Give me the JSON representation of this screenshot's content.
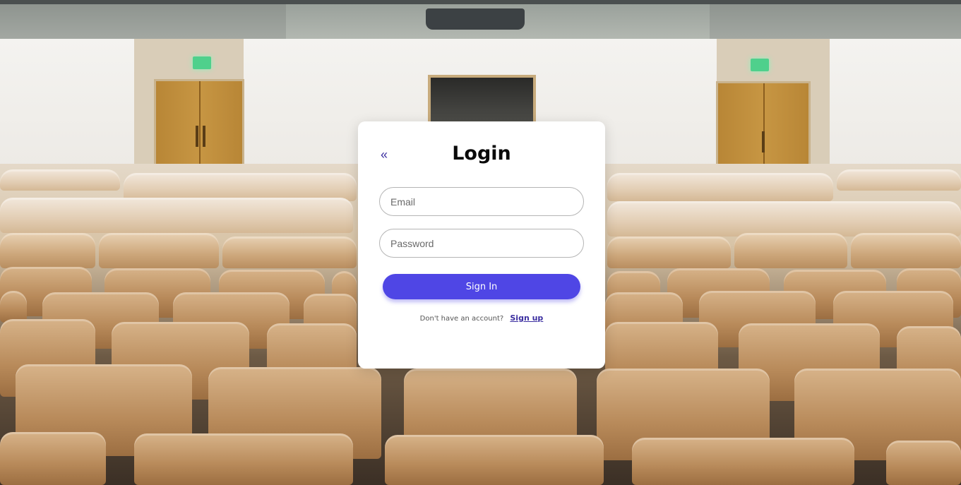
{
  "login": {
    "back_icon": "«",
    "title": "Login",
    "email_placeholder": "Email",
    "password_placeholder": "Password",
    "submit_label": "Sign In",
    "signup_prompt": "Don't have an account?",
    "signup_link": "Sign up"
  },
  "colors": {
    "accent": "#4f46e5",
    "link": "#3b2ea0",
    "card_background": "#ffffff"
  }
}
